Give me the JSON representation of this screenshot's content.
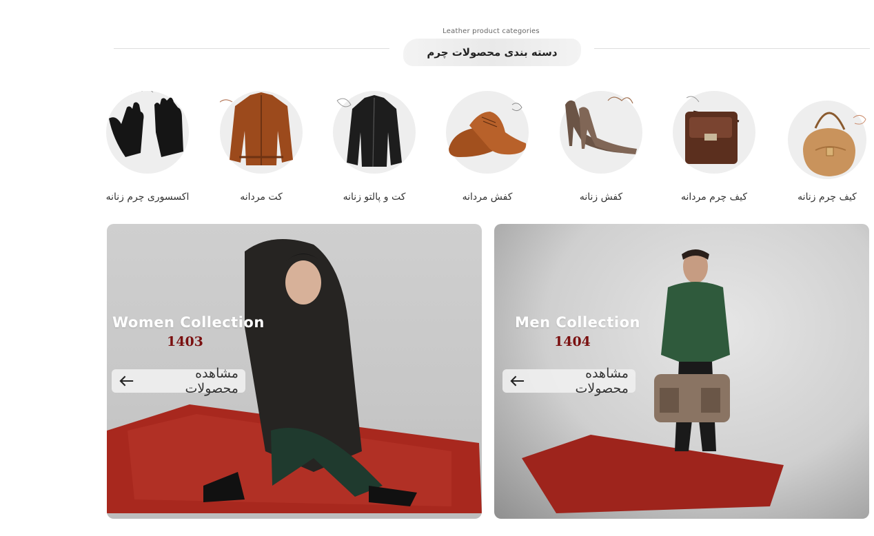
{
  "section": {
    "subtitle": "Leather product categories",
    "title": "دسته بندی محصولات چرم"
  },
  "categories": [
    {
      "label": "کیف چرم زنانه",
      "icon": "women-bag-icon"
    },
    {
      "label": "کیف چرم مردانه",
      "icon": "men-bag-icon"
    },
    {
      "label": "کفش زنانه",
      "icon": "heels-icon"
    },
    {
      "label": "کفش مردانه",
      "icon": "oxford-shoes-icon"
    },
    {
      "label": "کت و پالتو زنانه",
      "icon": "women-jacket-icon"
    },
    {
      "label": "کت مردانه",
      "icon": "men-jacket-icon"
    },
    {
      "label": "اکسسوری چرم زنانه",
      "icon": "gloves-icon"
    }
  ],
  "banners": {
    "women": {
      "title": "Women Collection",
      "year": "1403",
      "button": "مشاهده محصولات"
    },
    "men": {
      "title": "Men Collection",
      "year": "1404",
      "button": "مشاهده محصولات"
    }
  },
  "colors": {
    "accent_year": "#7a1010",
    "circle_bg": "#eeeeee",
    "rug_red": "#a8281e"
  }
}
